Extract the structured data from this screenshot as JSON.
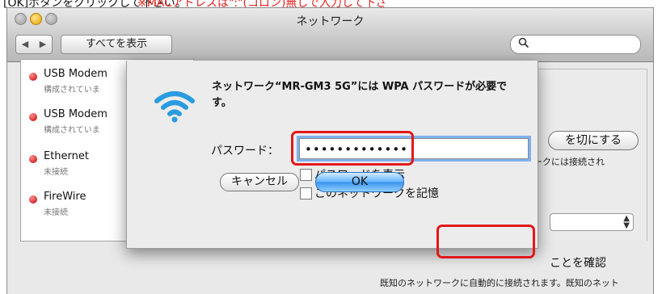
{
  "instruction": {
    "text": "[OK]ボタンをクリックして下さい。",
    "warning": "※MACアドレスは\":\"(コロン)無しで入力して下さ"
  },
  "window": {
    "title": "ネットワーク",
    "show_all_label": "すべてを表示",
    "back_glyph": "◀",
    "forward_glyph": "▶",
    "search_glyph": "🔍"
  },
  "sidebar": {
    "items": [
      {
        "name": "USB Modem",
        "status": "構成されていま",
        "status_color": "#d00000"
      },
      {
        "name": "USB Modem",
        "status": "構成されていま",
        "status_color": "#d00000"
      },
      {
        "name": "Ethernet",
        "status": "未接続",
        "status_color": "#d00000"
      },
      {
        "name": "FireWire",
        "status": "未接続",
        "status_color": "#d00000"
      }
    ]
  },
  "background_pane": {
    "turn_off_label": "を切にする",
    "connected_text": "ークには接続され",
    "confirm_text": "ことを確認",
    "auto_join_text": "既知のネットワークに自動的に接続されます。既知のネット"
  },
  "dialog": {
    "heading": "ネットワーク“MR-GM3 5G”には WPA パスワードが必要です。",
    "password_label": "パスワード：",
    "password_value": "•••••••••••••",
    "show_password_label": "パスワードを表示",
    "remember_network_label": "このネットワークを記憶",
    "cancel_label": "キャンセル",
    "ok_label": "OK"
  },
  "colors": {
    "callout": "#e2191b",
    "ok_button": "#4aa3f7",
    "wifi_icon": "#2a9be0"
  }
}
